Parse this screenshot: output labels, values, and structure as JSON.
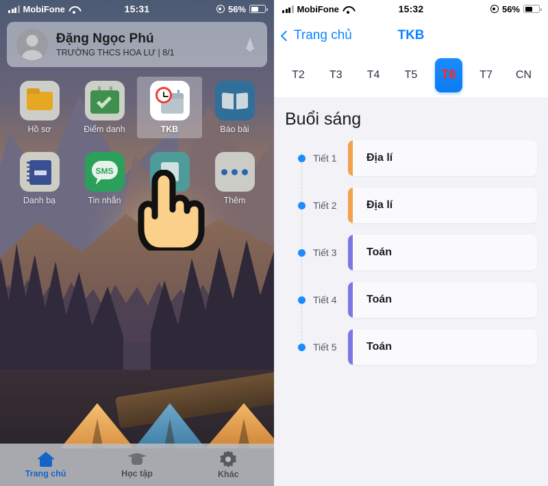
{
  "left": {
    "status": {
      "carrier": "MobiFone",
      "time": "15:31",
      "battery": "56%"
    },
    "profile": {
      "name": "Đặng Ngọc Phú",
      "school": "TRƯỜNG THCS HOA LƯ | 8/1"
    },
    "apps": [
      {
        "label": "Hồ sơ",
        "icon": "folder-icon"
      },
      {
        "label": "Điểm danh",
        "icon": "calendar-check-icon"
      },
      {
        "label": "TKB",
        "icon": "clock-calendar-icon"
      },
      {
        "label": "Báo bài",
        "icon": "open-book-icon"
      },
      {
        "label": "Danh bạ",
        "icon": "contacts-book-icon"
      },
      {
        "label": "Tin nhắn",
        "icon": "sms-bubble-icon"
      },
      {
        "label": "",
        "icon": "hidden-app-icon"
      },
      {
        "label": "Thêm",
        "icon": "more-dots-icon"
      }
    ],
    "sms_text": "SMS",
    "tabbar": [
      {
        "label": "Trang chủ",
        "icon": "home-icon"
      },
      {
        "label": "Học tập",
        "icon": "graduation-cap-icon"
      },
      {
        "label": "Khác",
        "icon": "gear-icon"
      }
    ]
  },
  "right": {
    "status": {
      "carrier": "MobiFone",
      "time": "15:32",
      "battery": "56%"
    },
    "nav": {
      "back_label": "Trang chủ",
      "title": "TKB"
    },
    "days": [
      {
        "label": "T2"
      },
      {
        "label": "T3"
      },
      {
        "label": "T4"
      },
      {
        "label": "T5"
      },
      {
        "label": "T6"
      },
      {
        "label": "T7"
      },
      {
        "label": "CN"
      }
    ],
    "selected_day": "T6",
    "session_title": "Buổi sáng",
    "periods": [
      {
        "period": "Tiết 1",
        "subject": "Địa lí",
        "color": "#F5A04A"
      },
      {
        "period": "Tiết 2",
        "subject": "Địa lí",
        "color": "#F5A04A"
      },
      {
        "period": "Tiết 3",
        "subject": "Toán",
        "color": "#7B78E5"
      },
      {
        "period": "Tiết 4",
        "subject": "Toán",
        "color": "#7B78E5"
      },
      {
        "period": "Tiết 5",
        "subject": "Toán",
        "color": "#7B78E5"
      }
    ]
  },
  "colors": {
    "accent_blue": "#0a84ff",
    "selected_red": "#ff2a1f",
    "dot_blue": "#1a8cff"
  }
}
